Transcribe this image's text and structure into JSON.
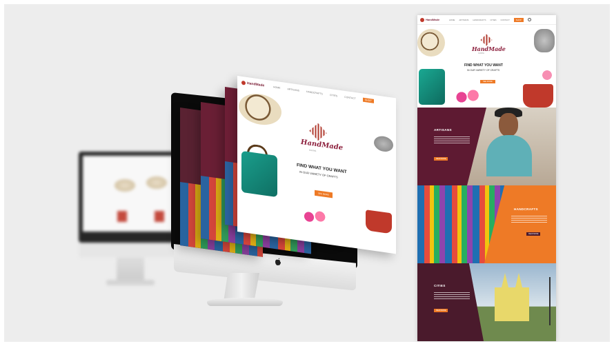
{
  "mockup_site": {
    "brand_name": "HandMade",
    "brand_sub": "CUNYA",
    "nav": [
      "HOME",
      "ARTISANS",
      "HANDCRAFTS",
      "CITIES",
      "CONTACT"
    ],
    "nav_cta": "SHOP",
    "hero_title": "FIND WHAT YOU WANT",
    "hero_sub": "IN OUR VARIETY OF CRAFTS",
    "hero_button": "SEE MORE",
    "sections": [
      {
        "title": "ARTISANS",
        "button": "READ MORE"
      },
      {
        "title": "HANDCRAFTS",
        "button": "READ MORE"
      },
      {
        "title": "CITIES",
        "button": "READ MORE"
      }
    ]
  },
  "colors": {
    "maroon": "#6a1f35",
    "orange": "#ee7a26",
    "background": "#ededed"
  },
  "icons": [
    "apple-logo-icon",
    "search-icon"
  ]
}
